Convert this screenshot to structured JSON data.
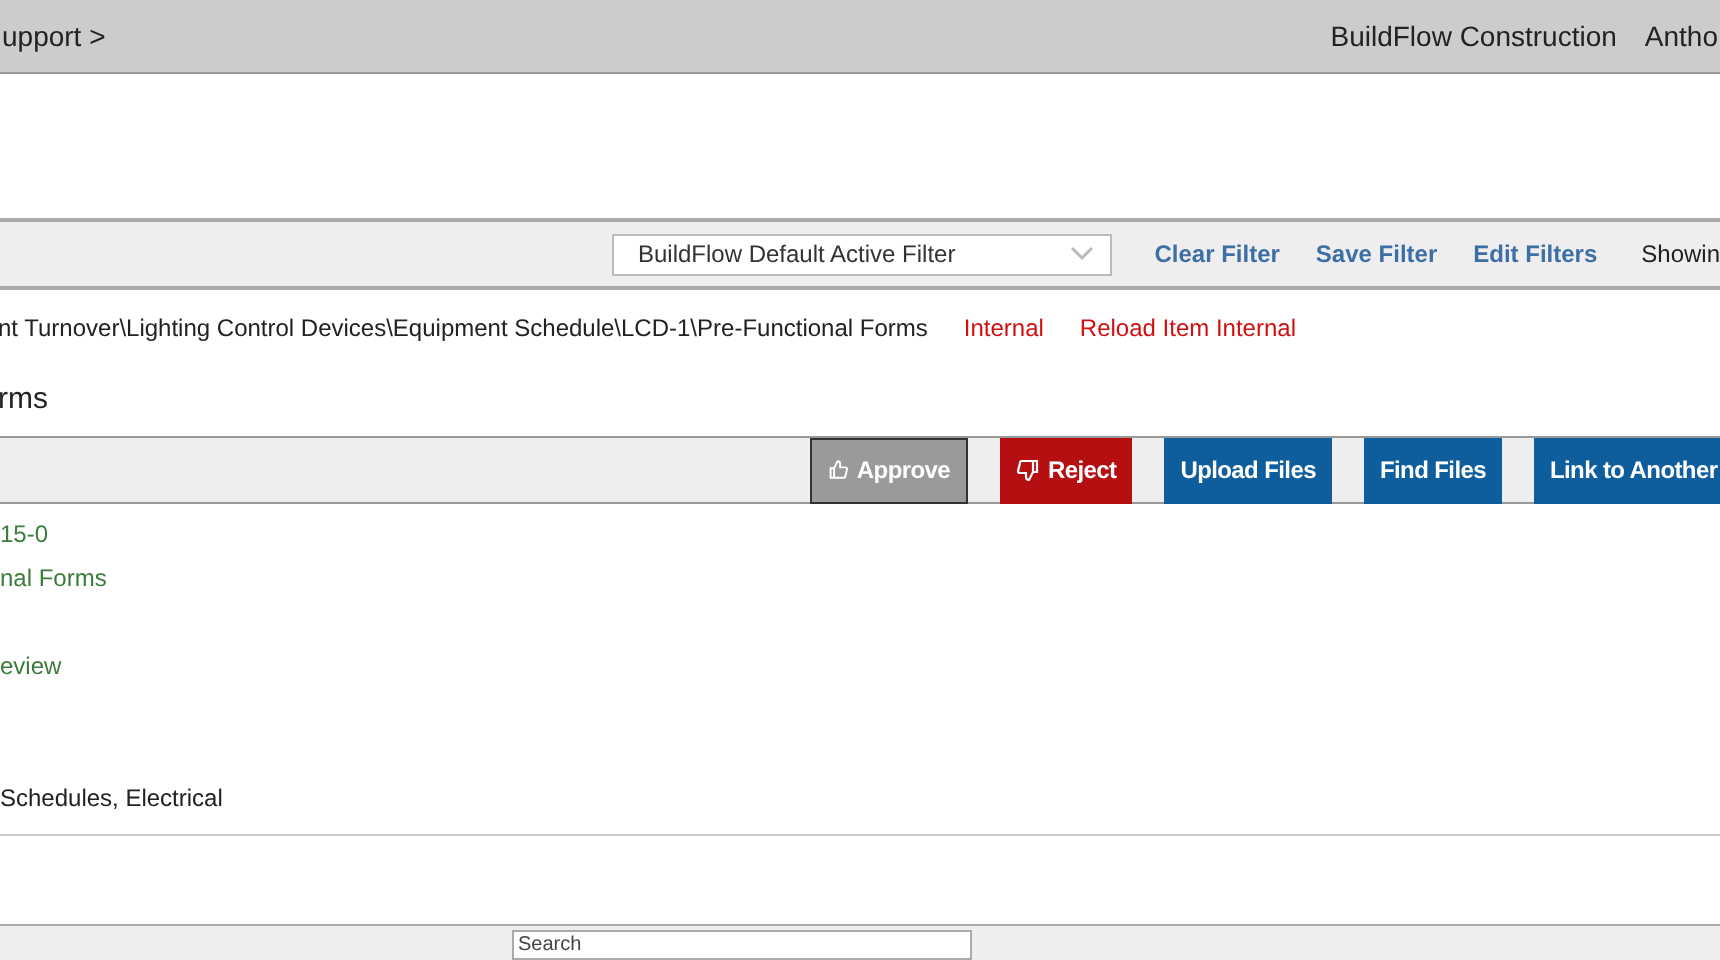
{
  "header": {
    "breadcrumb": "upport >",
    "company": "BuildFlow Construction",
    "user": "Antho"
  },
  "filter_bar": {
    "filter_select": "BuildFlow Default Active Filter",
    "links": [
      "Clear Filter",
      "Save Filter",
      "Edit Filters"
    ],
    "showing": "Showin"
  },
  "path": {
    "text": "nt Turnover\\Lighting Control Devices\\Equipment Schedule\\LCD-1\\Pre-Functional Forms",
    "links": [
      "Internal",
      "Reload Item Internal"
    ]
  },
  "section_title": "rms",
  "actions": [
    {
      "kind": "approve",
      "label": "Approve",
      "disabled": true
    },
    {
      "kind": "reject",
      "label": "Reject",
      "disabled": false
    },
    {
      "kind": "plain",
      "label": "Upload Files",
      "disabled": false
    },
    {
      "kind": "plain",
      "label": "Find Files",
      "disabled": false
    },
    {
      "kind": "plain",
      "label": "Link to Another",
      "disabled": false
    }
  ],
  "fields": [
    {
      "kind": "link",
      "value": "15-0"
    },
    {
      "kind": "link",
      "value": "nal Forms"
    },
    {
      "kind": "empty"
    },
    {
      "kind": "link",
      "value": "eview"
    },
    {
      "kind": "empty"
    },
    {
      "kind": "empty"
    },
    {
      "kind": "text",
      "value": "Schedules, Electrical"
    }
  ],
  "footer": {
    "search": {
      "placeholder": "Search"
    }
  }
}
